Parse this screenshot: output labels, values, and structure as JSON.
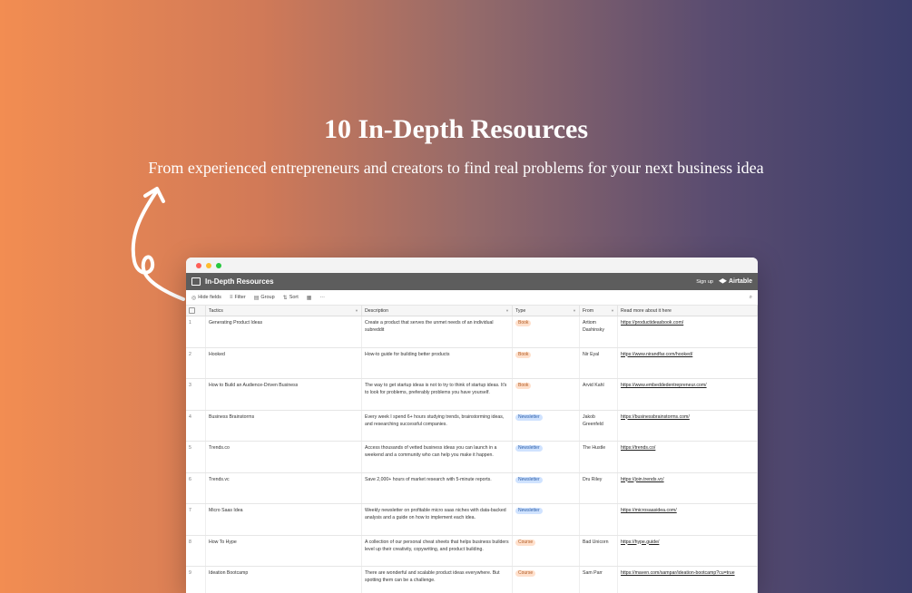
{
  "hero": {
    "title": "10 In-Depth Resources",
    "subtitle": "From experienced entrepreneurs and creators to find real problems for your next business idea"
  },
  "app": {
    "base_name": "In-Depth Resources",
    "signup": "Sign up",
    "brand": "Airtable"
  },
  "toolbar": {
    "hide_fields": "Hide fields",
    "filter": "Filter",
    "group": "Group",
    "sort": "Sort",
    "more": "···"
  },
  "columns": [
    "Tactics",
    "Description",
    "Type",
    "From",
    "Read more about it here"
  ],
  "rows": [
    {
      "num": "1",
      "tactic": "Generating Product Ideas",
      "description": "Create a product that serves the unmet needs of an individual subreddit",
      "type": "Book",
      "from": "Artiom Dashinsky",
      "link": "https://productideasbook.com/"
    },
    {
      "num": "2",
      "tactic": "Hooked",
      "description": "How-to guide for building better products",
      "type": "Book",
      "from": "Nir Eyal",
      "link": "https://www.nirandfar.com/hooked/"
    },
    {
      "num": "3",
      "tactic": "How to Build an Audience-Driven Business",
      "description": "The way to get startup ideas is not to try to think of startup ideas. It's to look for problems, preferably problems you have yourself.",
      "type": "Book",
      "from": "Arvid Kahl",
      "link": "https://www.embeddedentrepreneur.com/"
    },
    {
      "num": "4",
      "tactic": "Business Brainstorms",
      "description": "Every week I spend 6+ hours studying trends, brainstorming ideas, and researching successful companies.",
      "type": "Newsletter",
      "from": "Jakob Greenfeld",
      "link": "https://businessbrainstorms.com/"
    },
    {
      "num": "5",
      "tactic": "Trends.co",
      "description": "Access thousands of vetted business ideas you can launch in a weekend and a community who can help you make it happen.",
      "type": "Newsletter",
      "from": "The Hustle",
      "link": "https://trends.co/"
    },
    {
      "num": "6",
      "tactic": "Trends.vc",
      "description": "Save 2,000+ hours of market research with 5-minute reports.",
      "type": "Newsletter",
      "from": "Dru Riley",
      "link": "https://join.trends.vc/"
    },
    {
      "num": "7",
      "tactic": "Micro Saas Idea",
      "description": "Weekly newsletter on profitable micro saas niches with data-backed analysis and a guide on how to implement each idea.",
      "type": "Newsletter",
      "from": "",
      "link": "https://microsaasidea.com/"
    },
    {
      "num": "8",
      "tactic": "How To Hype",
      "description": "A collection of our personal cheat sheets that helps business builders level up their creativity, copywriting, and product building.",
      "type": "Course",
      "from": "Bad Unicorn",
      "link": "https://hype.guide/"
    },
    {
      "num": "9",
      "tactic": "Ideation Bootcamp",
      "description": "There are wonderful and scalable product ideas everywhere. But spotting them can be a challenge.",
      "type": "Course",
      "from": "Sam Parr",
      "link": "https://maven.com/sampar/ideation-bootcamp?cu=true"
    }
  ],
  "colors": {
    "gradient_left": "#f28d52",
    "gradient_right": "#3b3d6b",
    "chip_book_bg": "#ffe0cc",
    "chip_newsletter_bg": "#d0e3ff"
  }
}
